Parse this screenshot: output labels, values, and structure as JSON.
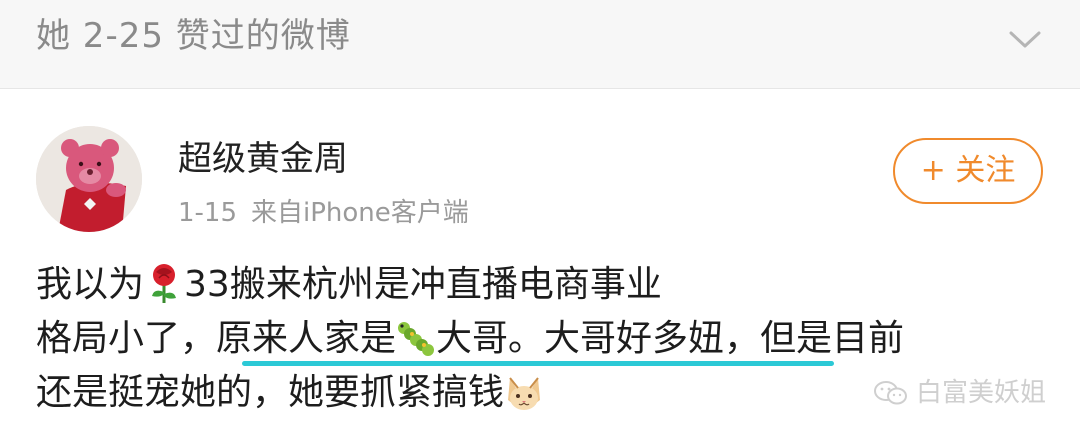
{
  "header": {
    "title": "她 2-25 赞过的微博"
  },
  "post": {
    "author": "超级黄金周",
    "date": "1-15",
    "source": "来自iPhone客户端",
    "follow_label": "+ 关注",
    "line1": {
      "a": "我以为",
      "b": "33搬来杭州是冲直播电商事业"
    },
    "line2": {
      "a": "格局小了，",
      "b": "原来人家是",
      "c": "大哥。大哥好多妞",
      "d": "，但是目前"
    },
    "line3": {
      "a": "还是挺宠她的，她要抓紧搞钱"
    }
  },
  "watermark": {
    "text": "白富美妖姐"
  },
  "icons": [
    "chevron-down-icon",
    "rose-icon",
    "caterpillar-icon",
    "cat-face-icon",
    "wechat-icon"
  ],
  "colors": {
    "follow": "#f08a2c",
    "highlight": "#2cc9d6",
    "header_bg": "#f7f7f7"
  }
}
